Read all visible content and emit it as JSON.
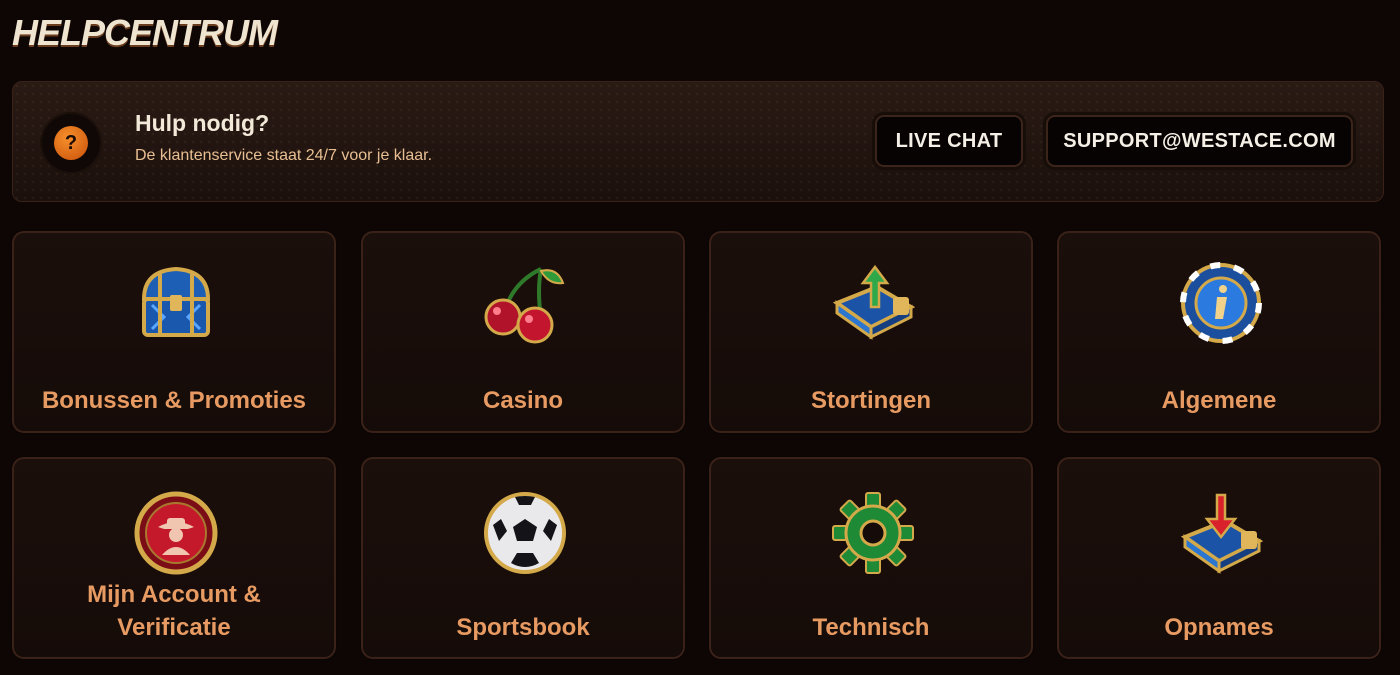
{
  "page": {
    "title": "HELPCENTRUM"
  },
  "help": {
    "badge": "?",
    "title": "Hulp nodig?",
    "subtitle": "De klantenservice staat 24/7 voor je klaar.",
    "live_chat": "LIVE CHAT",
    "email": "SUPPORT@WESTACE.COM"
  },
  "categories": [
    {
      "label": "Bonussen & Promoties",
      "icon": "treasure-chest-icon"
    },
    {
      "label": "Casino",
      "icon": "cherries-icon"
    },
    {
      "label": "Stortingen",
      "icon": "deposit-wallet-icon"
    },
    {
      "label": "Algemene",
      "icon": "info-chip-icon"
    },
    {
      "label_line1": "Mijn Account &",
      "label_line2": "Verificatie",
      "icon": "account-medal-icon"
    },
    {
      "label": "Sportsbook",
      "icon": "football-icon"
    },
    {
      "label": "Technisch",
      "icon": "gear-icon"
    },
    {
      "label": "Opnames",
      "icon": "withdraw-wallet-icon"
    }
  ],
  "colors": {
    "background": "#0d0605",
    "card_label": "#e79b62",
    "accent_orange": "#f7902c"
  }
}
